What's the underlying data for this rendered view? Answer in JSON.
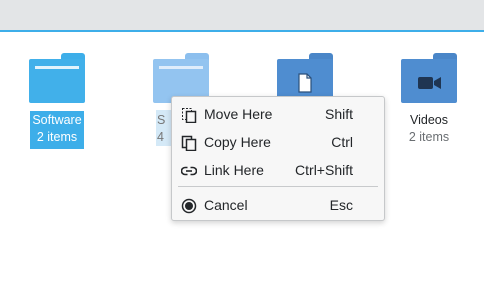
{
  "folders": [
    {
      "name": "Software",
      "count": "2 items",
      "icon": "folder-icon",
      "selected": true
    },
    {
      "name": "S",
      "count": "4",
      "icon": "folder-icon"
    },
    {
      "name": "",
      "count": "",
      "icon": "folder-documents-icon"
    },
    {
      "name": "Videos",
      "count": "2 items",
      "icon": "folder-videos-icon"
    }
  ],
  "context_menu": {
    "items": [
      {
        "label": "Move Here",
        "shortcut": "Shift",
        "icon": "move-icon"
      },
      {
        "label": "Copy Here",
        "shortcut": "Ctrl",
        "icon": "copy-icon"
      },
      {
        "label": "Link Here",
        "shortcut": "Ctrl+Shift",
        "icon": "link-icon"
      },
      {
        "label": "Cancel",
        "shortcut": "Esc",
        "icon": "cancel-icon"
      }
    ]
  },
  "colors": {
    "accent": "#3daee9",
    "folder": "#3daee9",
    "folder_dark": "#4a86c8"
  }
}
